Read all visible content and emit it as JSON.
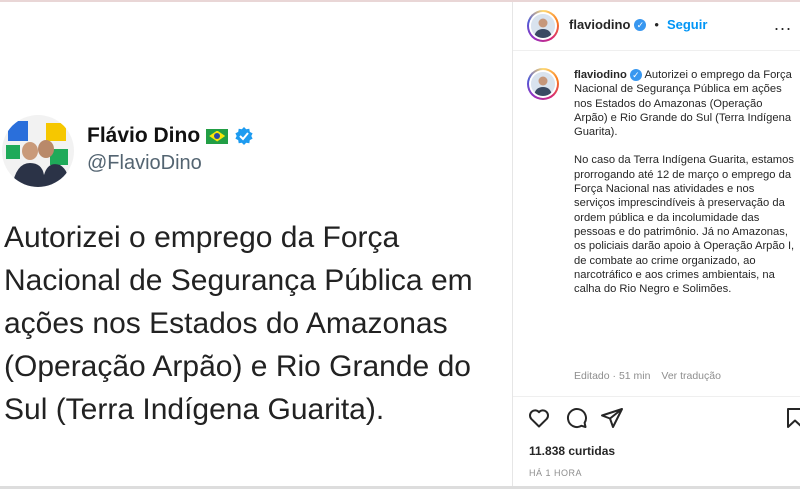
{
  "tweet": {
    "name": "Flávio Dino",
    "handle": "@FlavioDino",
    "text": "Autorizei o emprego da Força\nNacional de Segurança Pública em\nações nos Estados do Amazonas\n(Operação Arpão) e Rio Grande do\nSul (Terra Indígena Guarita)."
  },
  "post": {
    "username": "flaviodino",
    "follow_label": "Seguir",
    "separator": "•",
    "more_label": "...",
    "caption_p1": "Autorizei o emprego da Força Nacional de Segurança Pública em ações nos Estados do Amazonas (Operação Arpão) e Rio Grande do Sul (Terra Indígena Guarita).",
    "caption_p2": "No caso da Terra Indígena Guarita, estamos prorrogando até 12 de março o emprego da Força Nacional nas atividades e nos serviços imprescindíveis à preservação da ordem pública e da incolumidade das pessoas e do patrimônio. Já no Amazonas, os policiais darão apoio à Operação Arpão I, de combate ao crime organizado, ao narcotráfico e aos crimes ambientais, na calha do Rio Negro e Solimões.",
    "edited": "Editado · 51 min",
    "translate": "Ver tradução",
    "likes": "11.838 curtidas",
    "time": "HÁ 1 HORA"
  },
  "colors": {
    "accent": "#0095f6",
    "verified": "#3897f0"
  },
  "icons": [
    "heart-icon",
    "comment-icon",
    "share-icon",
    "bookmark-icon",
    "verified-icon",
    "brazil-flag-icon"
  ]
}
